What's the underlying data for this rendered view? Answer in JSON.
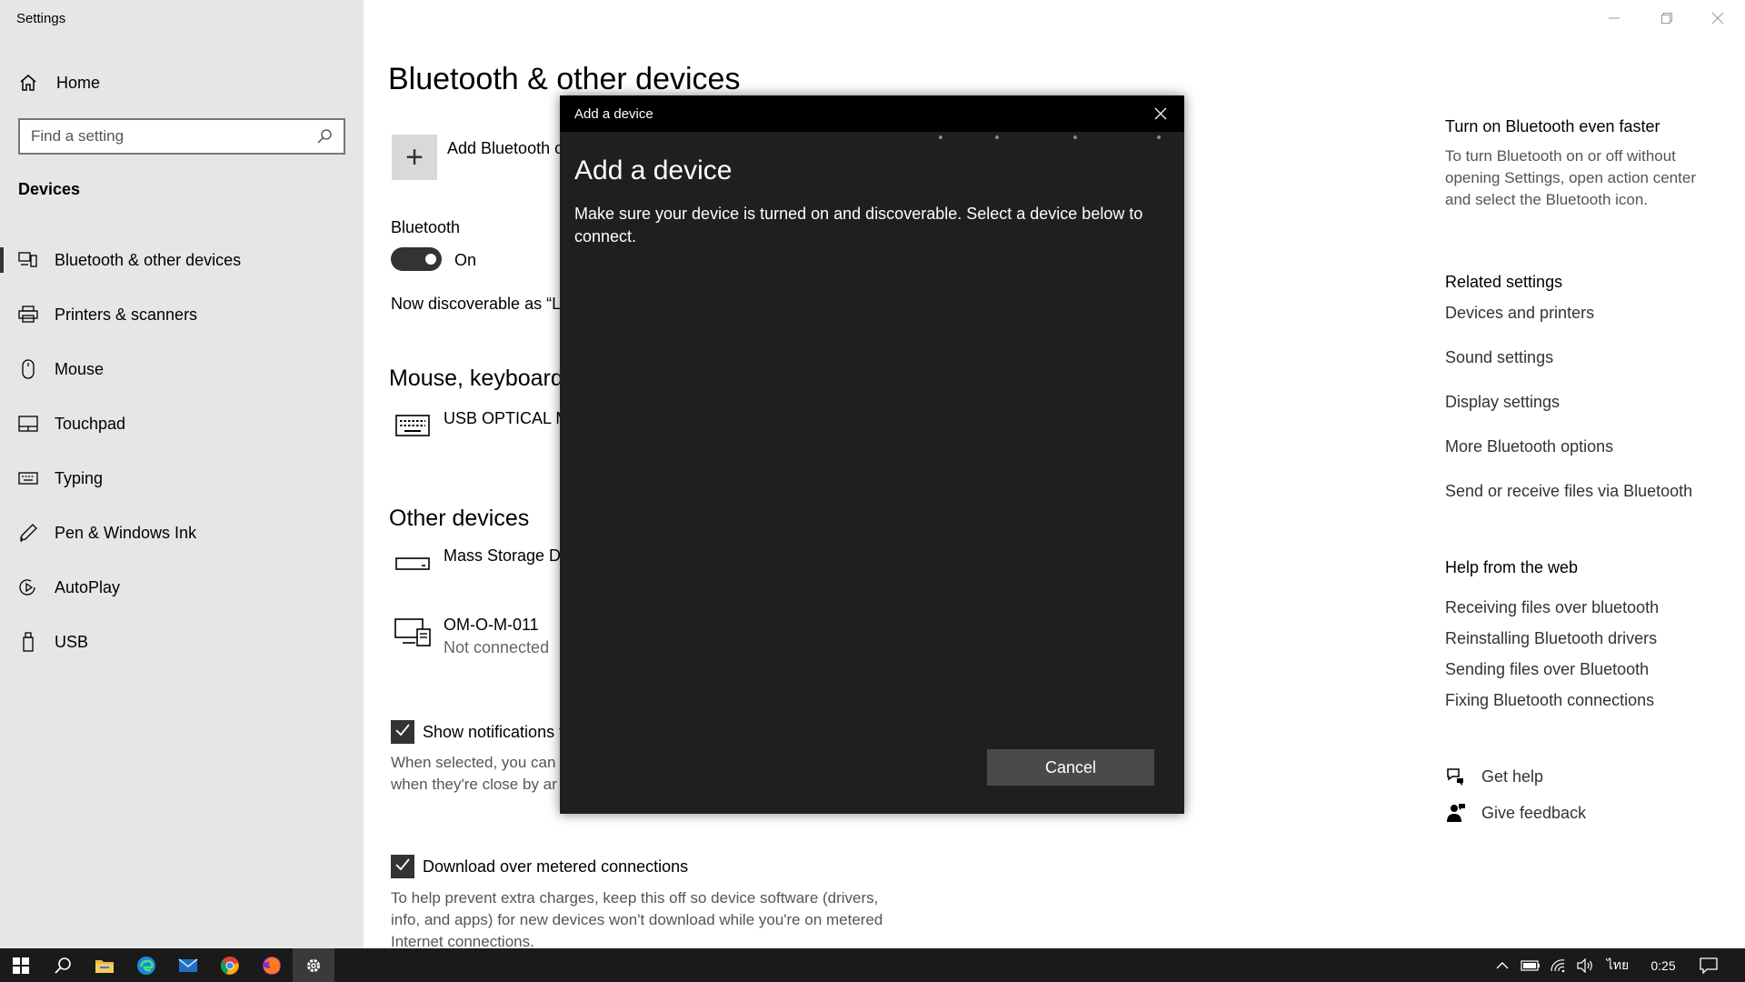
{
  "window": {
    "title": "Settings"
  },
  "sidebar": {
    "home_label": "Home",
    "search_placeholder": "Find a setting",
    "section": "Devices",
    "items": [
      {
        "label": "Bluetooth & other devices",
        "icon": "bluetooth-devices-icon",
        "active": true
      },
      {
        "label": "Printers & scanners",
        "icon": "printer-icon"
      },
      {
        "label": "Mouse",
        "icon": "mouse-icon"
      },
      {
        "label": "Touchpad",
        "icon": "touchpad-icon"
      },
      {
        "label": "Typing",
        "icon": "keyboard-icon"
      },
      {
        "label": "Pen & Windows Ink",
        "icon": "pen-icon"
      },
      {
        "label": "AutoPlay",
        "icon": "autoplay-icon"
      },
      {
        "label": "USB",
        "icon": "usb-icon"
      }
    ]
  },
  "main": {
    "title": "Bluetooth & other devices",
    "add_label": "Add Bluetooth o",
    "bluetooth_label": "Bluetooth",
    "toggle_state": "On",
    "discoverable_text": "Now discoverable as “LA",
    "mouse_section": "Mouse, keyboard",
    "mouse_device": "USB OPTICAL MC",
    "other_section": "Other devices",
    "other_devices": [
      {
        "name": "Mass Storage De",
        "status": ""
      },
      {
        "name": "OM-O-M-011",
        "status": "Not connected"
      }
    ],
    "show_notifications_label": "Show notifications t",
    "show_notifications_desc_1": "When selected, you can",
    "show_notifications_desc_2": "when they're close by ar",
    "download_label": "Download over metered connections",
    "download_desc": "To help prevent extra charges, keep this off so device software (drivers, info, and apps) for new devices won't download while you're on metered Internet connections."
  },
  "right_panel": {
    "tip_title": "Turn on Bluetooth even faster",
    "tip_text": "To turn Bluetooth on or off without opening Settings, open action center and select the Bluetooth icon.",
    "related_title": "Related settings",
    "related_links": [
      "Devices and printers",
      "Sound settings",
      "Display settings",
      "More Bluetooth options",
      "Send or receive files via Bluetooth"
    ],
    "help_title": "Help from the web",
    "help_links": [
      "Receiving files over bluetooth",
      "Reinstalling Bluetooth drivers",
      "Sending files over Bluetooth",
      "Fixing Bluetooth connections"
    ],
    "get_help": "Get help",
    "give_feedback": "Give feedback"
  },
  "dialog": {
    "titlebar": "Add a device",
    "heading": "Add a device",
    "description": "Make sure your device is turned on and discoverable. Select a device below to connect.",
    "cancel_label": "Cancel"
  },
  "taskbar": {
    "language": "ไทย",
    "time": "0:25"
  }
}
